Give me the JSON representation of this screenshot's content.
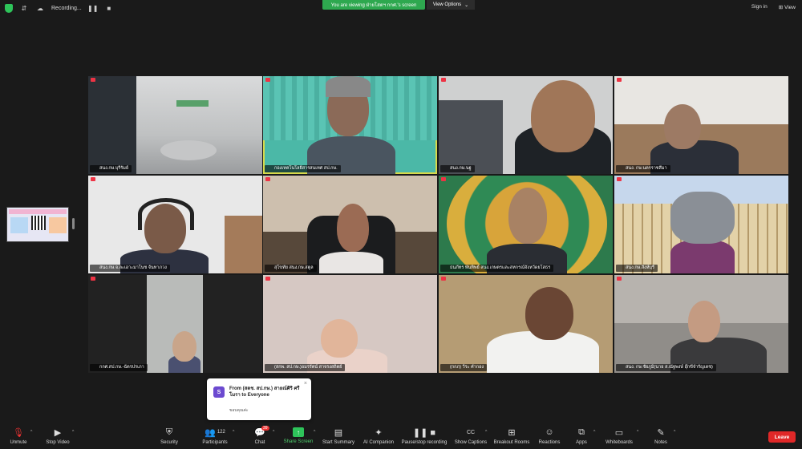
{
  "topbar": {
    "recording_label": "Recording...",
    "banner": "You are viewing ฝ่ายโสตฯ กกศ.'s screen",
    "view_options": "View Options",
    "sign_in": "Sign in",
    "view": "View"
  },
  "tiles": [
    {
      "name": "สนง.กษ.บุรีรัมย์"
    },
    {
      "name": "กองเทคโนโลยีสารสนเทศ สป.กษ."
    },
    {
      "name": "สนง.กษ.นฐ"
    },
    {
      "name": "สนง. กษ.นครราชสีมา"
    },
    {
      "name": "สนง.กษ.จ.ละเอาะมาโนช จันทาภวง"
    },
    {
      "name": "สุโขทัย สนง.กษ.สตูล"
    },
    {
      "name": "ธนภัทร พันทิพย์ สนง.เกษตรและสหกรณ์จังหวัดยโสธร"
    },
    {
      "name": "สนง.กษ.สิงห์บุรี"
    },
    {
      "name": "กกศ.สป.กษ.-ฉัตรปรเภา"
    },
    {
      "name": "(สกพ. สป.กษ.)อมรรัตน์ สาจรงสถิตย์"
    },
    {
      "name": "(กกภ) วีระ คำกอง"
    },
    {
      "name": "สนง. กษ.ชัยภูมิ(นาย ส.ณัฐพงษ์ อุ๊กขีจำรัญเดช)"
    }
  ],
  "chat_popup": {
    "avatar_letter": "S",
    "from": "From (สดช. สป.กษ.) สายณ์ศิริ ศรีโมรา to Everyone",
    "message": "ขอบคุณค่ะ"
  },
  "toolbar": {
    "unmute": "Unmute",
    "stop_video": "Stop Video",
    "security": "Security",
    "participants": "Participants",
    "participants_count": "122",
    "chat": "Chat",
    "chat_badge": "39",
    "share_screen": "Share Screen",
    "start_summary": "Start Summary",
    "ai_companion": "AI Companion",
    "pause_stop_recording": "Pause/stop recording",
    "show_captions": "Show Captions",
    "breakout_rooms": "Breakout Rooms",
    "reactions": "Reactions",
    "apps": "Apps",
    "whiteboards": "Whiteboards",
    "notes": "Notes",
    "leave": "Leave"
  },
  "colors": {
    "banner_green": "#2ea84f",
    "leave_red": "#e02828",
    "active_speaker": "#d7d94a"
  }
}
